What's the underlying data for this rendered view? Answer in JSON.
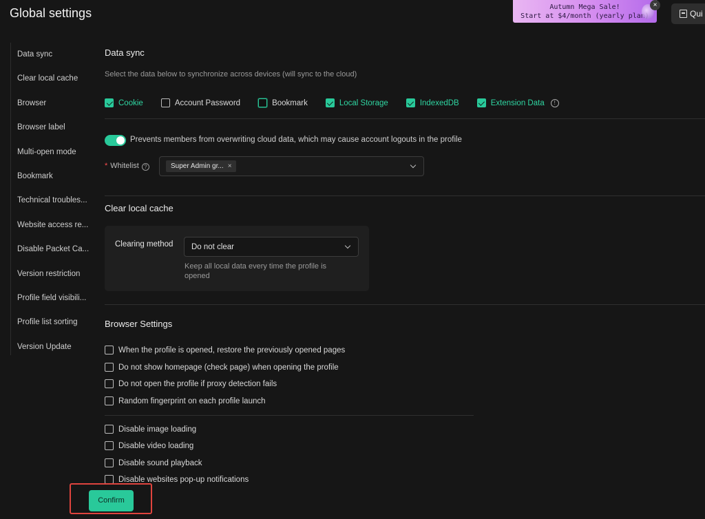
{
  "page_title": "Global settings",
  "promo": {
    "line1": "Autumn Mega Sale!",
    "line2": "Start at $4/month (yearly plan)",
    "close_icon": "×"
  },
  "quick_button": {
    "label": "Qui"
  },
  "sidebar": {
    "items": [
      "Data sync",
      "Clear local cache",
      "Browser",
      "Browser label",
      "Multi-open mode",
      "Bookmark",
      "Technical troubles...",
      "Website access re...",
      "Disable Packet Ca...",
      "Version restriction",
      "Profile field visibili...",
      "Profile list sorting",
      "Version Update"
    ]
  },
  "data_sync": {
    "title": "Data sync",
    "description": "Select the data below to synchronize across devices (will sync to the cloud)",
    "options": [
      {
        "label": "Cookie",
        "checked": true
      },
      {
        "label": "Account Password",
        "checked": false
      },
      {
        "label": "Bookmark",
        "checked": false
      },
      {
        "label": "Local Storage",
        "checked": true
      },
      {
        "label": "IndexedDB",
        "checked": true
      },
      {
        "label": "Extension Data",
        "checked": true
      }
    ],
    "info_icon": "!",
    "toggle_label": "Prevents members from overwriting cloud data, which may cause account logouts in the profile",
    "toggle_on": true,
    "whitelist_required": "*",
    "whitelist_label": "Whitelist",
    "help_icon": "?",
    "whitelist_tag": "Super Admin gr...",
    "tag_close": "×"
  },
  "clear_cache": {
    "title": "Clear local cache",
    "method_label": "Clearing method",
    "method_value": "Do not clear",
    "hint": "Keep all local data every time the profile is opened"
  },
  "browser_settings": {
    "title": "Browser Settings",
    "group1": [
      "When the profile is opened, restore the previously opened pages",
      "Do not show homepage (check page) when opening the profile",
      "Do not open the profile if proxy detection fails",
      "Random fingerprint on each profile launch"
    ],
    "group2": [
      "Disable image loading",
      "Disable video loading",
      "Disable sound playback",
      "Disable websites pop-up notifications"
    ]
  },
  "confirm_label": "Confirm",
  "colors": {
    "accent": "#29c99a",
    "background": "#161616",
    "highlight_outline": "#e0443e",
    "promo_gradient_start": "#e9b6f2",
    "promo_gradient_end": "#b46bea"
  }
}
